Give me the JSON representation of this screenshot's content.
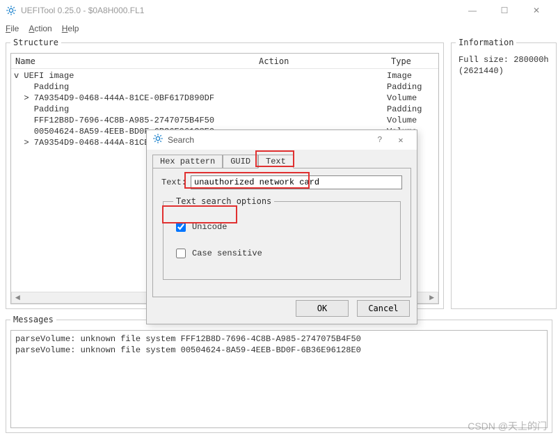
{
  "window": {
    "title": "UEFITool 0.25.0 - $0A8H000.FL1",
    "minimize": "—",
    "maximize": "☐",
    "close": "✕"
  },
  "menubar": {
    "file": "File",
    "action": "Action",
    "help": "Help"
  },
  "panels": {
    "structure_legend": "Structure",
    "information_legend": "Information",
    "messages_legend": "Messages"
  },
  "tree": {
    "headers": {
      "name": "Name",
      "action": "Action",
      "type": "Type"
    },
    "rows": [
      {
        "indent": 0,
        "caret": "v",
        "name": "UEFI image",
        "type": "Image"
      },
      {
        "indent": 1,
        "caret": " ",
        "name": "Padding",
        "type": "Padding"
      },
      {
        "indent": 1,
        "caret": ">",
        "name": "7A9354D9-0468-444A-81CE-0BF617D890DF",
        "type": "Volume"
      },
      {
        "indent": 1,
        "caret": " ",
        "name": "Padding",
        "type": "Padding"
      },
      {
        "indent": 1,
        "caret": " ",
        "name": "FFF12B8D-7696-4C8B-A985-2747075B4F50",
        "type": "Volume"
      },
      {
        "indent": 1,
        "caret": " ",
        "name": "00504624-8A59-4EEB-BD0F-6B36E96128E0",
        "type": "Volume"
      },
      {
        "indent": 1,
        "caret": ">",
        "name": "7A9354D9-0468-444A-81CE-",
        "type": ""
      }
    ]
  },
  "information": {
    "line1": "Full size: 280000h",
    "line2": "(2621440)"
  },
  "messages": {
    "line1": "parseVolume: unknown file system FFF12B8D-7696-4C8B-A985-2747075B4F50",
    "line2": "parseVolume: unknown file system 00504624-8A59-4EEB-BD0F-6B36E96128E0"
  },
  "dialog": {
    "title": "Search",
    "help": "?",
    "close": "✕",
    "tabs": {
      "hex": "Hex pattern",
      "guid": "GUID",
      "text": "Text"
    },
    "text_label": "Text:",
    "text_value": "unauthorized network card",
    "options_legend": "Text search options",
    "unicode_label": "Unicode",
    "unicode_checked": true,
    "case_label": "Case sensitive",
    "case_checked": false,
    "ok": "OK",
    "cancel": "Cancel"
  },
  "watermark": "CSDN @天上的门"
}
